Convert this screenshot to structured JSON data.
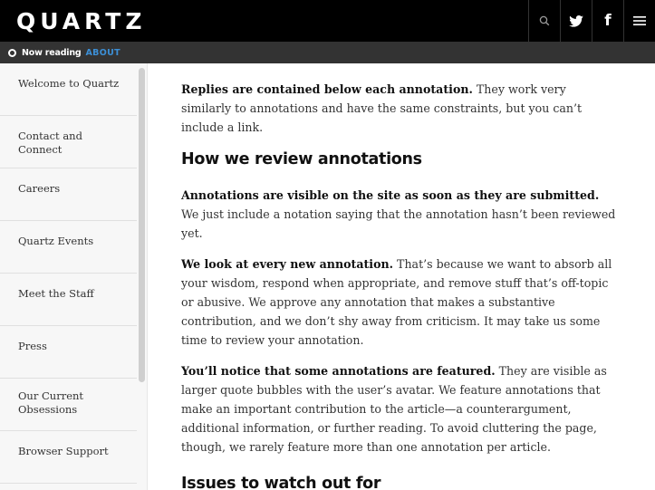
{
  "header": {
    "logo": "QUARTZ",
    "icons": [
      "search-icon",
      "twitter-icon",
      "facebook-icon",
      "menu-icon"
    ],
    "twitter_glyph": "🐦",
    "facebook_glyph": "f",
    "menu_glyph": "≡"
  },
  "now_reading": {
    "label": "Now reading",
    "section": "ABOUT",
    "section_color": "#3c8fd6"
  },
  "sidebar": {
    "items": [
      {
        "label": "Welcome to Quartz"
      },
      {
        "label": "Contact and Connect"
      },
      {
        "label": "Careers"
      },
      {
        "label": "Quartz Events"
      },
      {
        "label": "Meet the Staff"
      },
      {
        "label": "Press"
      },
      {
        "label": "Our Current Obsessions"
      },
      {
        "label": "Browser Support"
      }
    ]
  },
  "article": {
    "p1_bold": "Replies are contained below each annotation.",
    "p1_text": " They work very similarly to annotations and have the same constraints, but you can’t include a link.",
    "h2_review": "How we review annotations",
    "p2_bold": "Annotations are visible on the site as soon as they are submitted.",
    "p2_text": " We just include a notation saying that the annotation hasn’t been reviewed yet.",
    "p3_bold": "We look at every new annotation.",
    "p3_text": " That’s because we want to absorb all your wisdom, respond when appropriate, and remove stuff that’s off-topic or abusive. We approve any annotation that makes a substantive contribution, and we don’t shy away from criticism. It may take us some time to review your annotation.",
    "p4_bold": "You’ll notice that some annotations are featured.",
    "p4_text": " They are visible as larger quote bubbles with the user’s avatar. We feature annotations that make an important contribution to the article—a counterargument, additional information, or further reading. To avoid cluttering the page, though, we rarely feature more than one annotation per article.",
    "h2_issues": "Issues to watch out for"
  }
}
